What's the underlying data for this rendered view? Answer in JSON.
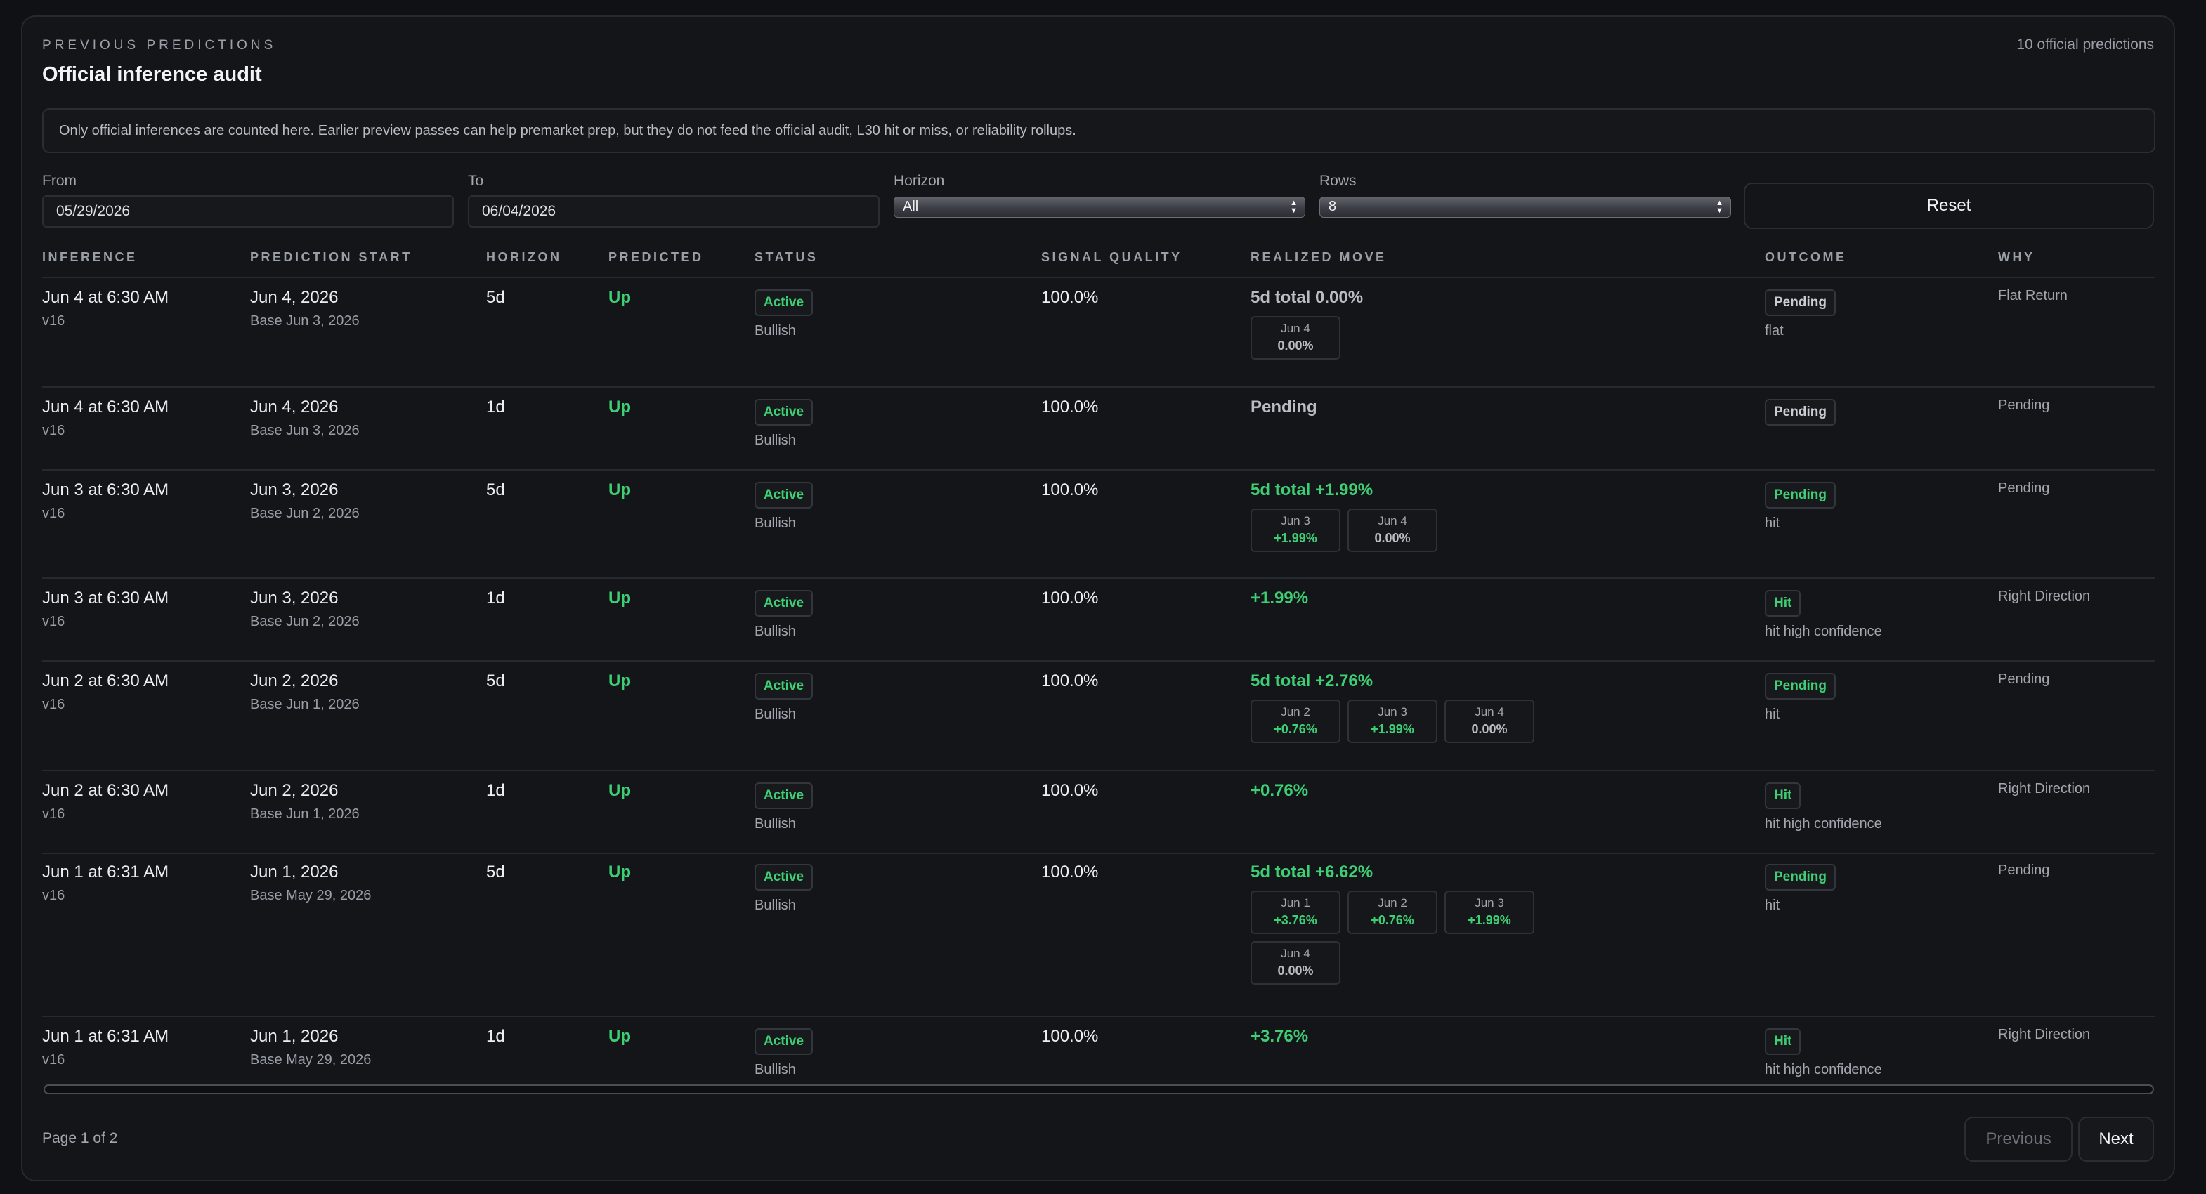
{
  "header": {
    "kicker": "PREVIOUS PREDICTIONS",
    "title": "Official inference audit",
    "count": "10 official predictions"
  },
  "notice": "Only official inferences are counted here. Earlier preview passes can help premarket prep, but they do not feed the official audit, L30 hit or miss, or reliability rollups.",
  "filters": {
    "from_label": "From",
    "from_value": "05/29/2026",
    "to_label": "To",
    "to_value": "06/04/2026",
    "horizon_label": "Horizon",
    "horizon_value": "All",
    "rows_label": "Rows",
    "rows_value": "8",
    "reset_label": "Reset"
  },
  "columns": {
    "inference": "INFERENCE",
    "prediction_start": "PREDICTION START",
    "horizon": "HORIZON",
    "predicted": "PREDICTED",
    "status": "STATUS",
    "signal_quality": "SIGNAL QUALITY",
    "realized_move": "REALIZED MOVE",
    "outcome": "OUTCOME",
    "why": "WHY"
  },
  "rows": [
    {
      "inference": "Jun 4 at 6:30 AM",
      "version": "v16",
      "start": "Jun 4, 2026",
      "base": "Base Jun 3, 2026",
      "horizon": "5d",
      "predicted": "Up",
      "status": "Active",
      "stance": "Bullish",
      "quality": "100.0%",
      "move": "5d total 0.00%",
      "move_tone": "neutral",
      "chips": [
        {
          "date": "Jun 4",
          "value": "0.00%",
          "tone": "neutral"
        }
      ],
      "outcome": "Pending",
      "outcome_tone": "gray",
      "outcome_note": "flat",
      "why": "Flat Return"
    },
    {
      "inference": "Jun 4 at 6:30 AM",
      "version": "v16",
      "start": "Jun 4, 2026",
      "base": "Base Jun 3, 2026",
      "horizon": "1d",
      "predicted": "Up",
      "status": "Active",
      "stance": "Bullish",
      "quality": "100.0%",
      "move": "Pending",
      "move_tone": "neutral",
      "chips": [],
      "outcome": "Pending",
      "outcome_tone": "gray",
      "outcome_note": "",
      "why": "Pending"
    },
    {
      "inference": "Jun 3 at 6:30 AM",
      "version": "v16",
      "start": "Jun 3, 2026",
      "base": "Base Jun 2, 2026",
      "horizon": "5d",
      "predicted": "Up",
      "status": "Active",
      "stance": "Bullish",
      "quality": "100.0%",
      "move": "5d total +1.99%",
      "move_tone": "pos",
      "chips": [
        {
          "date": "Jun 3",
          "value": "+1.99%",
          "tone": "pos"
        },
        {
          "date": "Jun 4",
          "value": "0.00%",
          "tone": "neutral"
        }
      ],
      "outcome": "Pending",
      "outcome_tone": "green",
      "outcome_note": "hit",
      "why": "Pending"
    },
    {
      "inference": "Jun 3 at 6:30 AM",
      "version": "v16",
      "start": "Jun 3, 2026",
      "base": "Base Jun 2, 2026",
      "horizon": "1d",
      "predicted": "Up",
      "status": "Active",
      "stance": "Bullish",
      "quality": "100.0%",
      "move": "+1.99%",
      "move_tone": "pos",
      "chips": [],
      "outcome": "Hit",
      "outcome_tone": "green",
      "outcome_note": "hit high confidence",
      "why": "Right Direction"
    },
    {
      "inference": "Jun 2 at 6:30 AM",
      "version": "v16",
      "start": "Jun 2, 2026",
      "base": "Base Jun 1, 2026",
      "horizon": "5d",
      "predicted": "Up",
      "status": "Active",
      "stance": "Bullish",
      "quality": "100.0%",
      "move": "5d total +2.76%",
      "move_tone": "pos",
      "chips": [
        {
          "date": "Jun 2",
          "value": "+0.76%",
          "tone": "pos"
        },
        {
          "date": "Jun 3",
          "value": "+1.99%",
          "tone": "pos"
        },
        {
          "date": "Jun 4",
          "value": "0.00%",
          "tone": "neutral"
        }
      ],
      "outcome": "Pending",
      "outcome_tone": "green",
      "outcome_note": "hit",
      "why": "Pending"
    },
    {
      "inference": "Jun 2 at 6:30 AM",
      "version": "v16",
      "start": "Jun 2, 2026",
      "base": "Base Jun 1, 2026",
      "horizon": "1d",
      "predicted": "Up",
      "status": "Active",
      "stance": "Bullish",
      "quality": "100.0%",
      "move": "+0.76%",
      "move_tone": "pos",
      "chips": [],
      "outcome": "Hit",
      "outcome_tone": "green",
      "outcome_note": "hit high confidence",
      "why": "Right Direction"
    },
    {
      "inference": "Jun 1 at 6:31 AM",
      "version": "v16",
      "start": "Jun 1, 2026",
      "base": "Base May 29, 2026",
      "horizon": "5d",
      "predicted": "Up",
      "status": "Active",
      "stance": "Bullish",
      "quality": "100.0%",
      "move": "5d total +6.62%",
      "move_tone": "pos",
      "chips": [
        {
          "date": "Jun 1",
          "value": "+3.76%",
          "tone": "pos"
        },
        {
          "date": "Jun 2",
          "value": "+0.76%",
          "tone": "pos"
        },
        {
          "date": "Jun 3",
          "value": "+1.99%",
          "tone": "pos"
        },
        {
          "date": "Jun 4",
          "value": "0.00%",
          "tone": "neutral"
        }
      ],
      "outcome": "Pending",
      "outcome_tone": "green",
      "outcome_note": "hit",
      "why": "Pending"
    },
    {
      "inference": "Jun 1 at 6:31 AM",
      "version": "v16",
      "start": "Jun 1, 2026",
      "base": "Base May 29, 2026",
      "horizon": "1d",
      "predicted": "Up",
      "status": "Active",
      "stance": "Bullish",
      "quality": "100.0%",
      "move": "+3.76%",
      "move_tone": "pos",
      "chips": [],
      "outcome": "Hit",
      "outcome_tone": "green",
      "outcome_note": "hit high confidence",
      "why": "Right Direction"
    }
  ],
  "pagination": {
    "info": "Page 1 of 2",
    "previous_label": "Previous",
    "next_label": "Next"
  }
}
